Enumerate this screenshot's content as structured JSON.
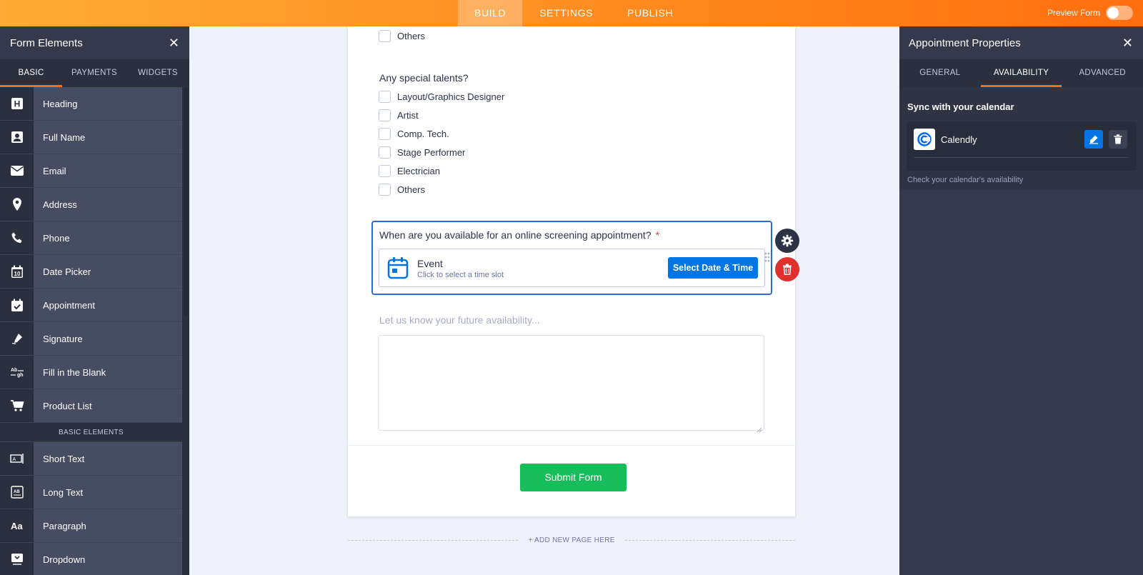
{
  "topbar": {
    "tabs": [
      "BUILD",
      "SETTINGS",
      "PUBLISH"
    ],
    "active_tab": "BUILD",
    "preview_label": "Preview Form",
    "preview_enabled": false
  },
  "left_panel": {
    "title": "Form Elements",
    "tabs": [
      "BASIC",
      "PAYMENTS",
      "WIDGETS"
    ],
    "active_tab": "BASIC",
    "items": [
      {
        "label": "Heading",
        "icon": "heading-icon"
      },
      {
        "label": "Full Name",
        "icon": "user-card-icon"
      },
      {
        "label": "Email",
        "icon": "envelope-icon"
      },
      {
        "label": "Address",
        "icon": "map-pin-icon"
      },
      {
        "label": "Phone",
        "icon": "phone-icon"
      },
      {
        "label": "Date Picker",
        "icon": "calendar-icon"
      },
      {
        "label": "Appointment",
        "icon": "calendar-check-icon"
      },
      {
        "label": "Signature",
        "icon": "pen-icon"
      },
      {
        "label": "Fill in the Blank",
        "icon": "fill-blank-icon"
      },
      {
        "label": "Product List",
        "icon": "cart-icon"
      }
    ],
    "section_label": "BASIC ELEMENTS",
    "items2": [
      {
        "label": "Short Text",
        "icon": "short-text-icon"
      },
      {
        "label": "Long Text",
        "icon": "long-text-icon"
      },
      {
        "label": "Paragraph",
        "icon": "paragraph-icon"
      },
      {
        "label": "Dropdown",
        "icon": "dropdown-icon"
      }
    ]
  },
  "form": {
    "prev_others": "Others",
    "talents_label": "Any special talents?",
    "talents": [
      "Layout/Graphics Designer",
      "Artist",
      "Comp. Tech.",
      "Stage Performer",
      "Electrician",
      "Others"
    ],
    "appointment_question": "When are you available for an online screening appointment?",
    "required_mark": "*",
    "event_title": "Event",
    "event_subtitle": "Click to select a time slot",
    "select_button": "Select Date & Time",
    "future_label": "Let us know your future availability...",
    "submit_label": "Submit Form",
    "add_page": "+ ADD NEW PAGE HERE"
  },
  "right_panel": {
    "title": "Appointment Properties",
    "tabs": [
      "GENERAL",
      "AVAILABILITY",
      "ADVANCED"
    ],
    "active_tab": "AVAILABILITY",
    "sync_title": "Sync with your calendar",
    "calendar_name": "Calendly",
    "hint": "Check your calendar's availability"
  },
  "colors": {
    "accent_orange": "#ff6e0f",
    "primary_blue": "#0075e3",
    "submit_green": "#18bd5b",
    "delete_red": "#e0302d"
  }
}
